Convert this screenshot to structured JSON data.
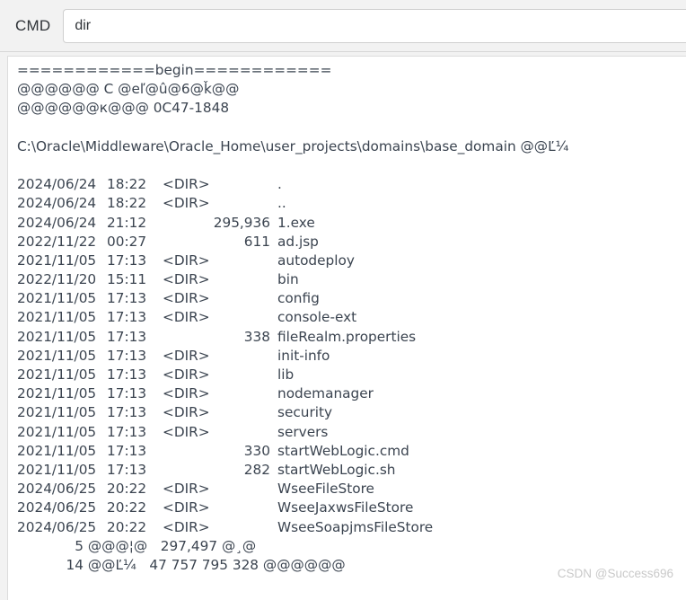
{
  "window": {
    "title": "CMD"
  },
  "command_bar": {
    "label": "CMD",
    "input_value": "dir",
    "input_placeholder": ""
  },
  "output": {
    "banner": "============begin============",
    "volume_label_line": "@@@@@@ C @eľ@û@6@ǩ@@",
    "volume_serial_line": "@@@@@@к@@@ 0C47-1848",
    "blank_line": "",
    "path_line": "C:\\Oracle\\Middleware\\Oracle_Home\\user_projects\\domains\\base_domain @@Ľ¼",
    "listing_header_blank": "",
    "entries": [
      {
        "date": "2024/06/24",
        "time": "18:22",
        "size": "",
        "dir": "<DIR>",
        "name": "."
      },
      {
        "date": "2024/06/24",
        "time": "18:22",
        "size": "",
        "dir": "<DIR>",
        "name": ".."
      },
      {
        "date": "2024/06/24",
        "time": "21:12",
        "size": "295,936",
        "dir": "",
        "name": "1.exe"
      },
      {
        "date": "2022/11/22",
        "time": "00:27",
        "size": "611",
        "dir": "",
        "name": "ad.jsp"
      },
      {
        "date": "2021/11/05",
        "time": "17:13",
        "size": "",
        "dir": "<DIR>",
        "name": "autodeploy"
      },
      {
        "date": "2022/11/20",
        "time": "15:11",
        "size": "",
        "dir": "<DIR>",
        "name": "bin"
      },
      {
        "date": "2021/11/05",
        "time": "17:13",
        "size": "",
        "dir": "<DIR>",
        "name": "config"
      },
      {
        "date": "2021/11/05",
        "time": "17:13",
        "size": "",
        "dir": "<DIR>",
        "name": "console-ext"
      },
      {
        "date": "2021/11/05",
        "time": "17:13",
        "size": "338",
        "dir": "",
        "name": "fileRealm.properties"
      },
      {
        "date": "2021/11/05",
        "time": "17:13",
        "size": "",
        "dir": "<DIR>",
        "name": "init-info"
      },
      {
        "date": "2021/11/05",
        "time": "17:13",
        "size": "",
        "dir": "<DIR>",
        "name": "lib"
      },
      {
        "date": "2021/11/05",
        "time": "17:13",
        "size": "",
        "dir": "<DIR>",
        "name": "nodemanager"
      },
      {
        "date": "2021/11/05",
        "time": "17:13",
        "size": "",
        "dir": "<DIR>",
        "name": "security"
      },
      {
        "date": "2021/11/05",
        "time": "17:13",
        "size": "",
        "dir": "<DIR>",
        "name": "servers"
      },
      {
        "date": "2021/11/05",
        "time": "17:13",
        "size": "330",
        "dir": "",
        "name": "startWebLogic.cmd"
      },
      {
        "date": "2021/11/05",
        "time": "17:13",
        "size": "282",
        "dir": "",
        "name": "startWebLogic.sh"
      },
      {
        "date": "2024/06/25",
        "time": "20:22",
        "size": "",
        "dir": "<DIR>",
        "name": "WseeFileStore"
      },
      {
        "date": "2024/06/25",
        "time": "20:22",
        "size": "",
        "dir": "<DIR>",
        "name": "WseeJaxwsFileStore"
      },
      {
        "date": "2024/06/25",
        "time": "20:22",
        "size": "",
        "dir": "<DIR>",
        "name": "WseeSoapjmsFileStore"
      }
    ],
    "summary_files": {
      "count": "5",
      "label": "@@@¦@",
      "bytes": "297,497",
      "unit": "@¸@"
    },
    "summary_dirs": {
      "count": "14",
      "label": "@@Ľ¼",
      "bytes": "47 757 795 328",
      "unit": "@@@@@@"
    }
  },
  "watermark": {
    "text": "CSDN @Success696"
  },
  "colors": {
    "page_background": "#f2f2f2",
    "panel_background": "#ffffff",
    "text": "#3b4450",
    "label_text": "#2f3338",
    "border": "#dcdcdc",
    "watermark": "#c9c9c9"
  }
}
